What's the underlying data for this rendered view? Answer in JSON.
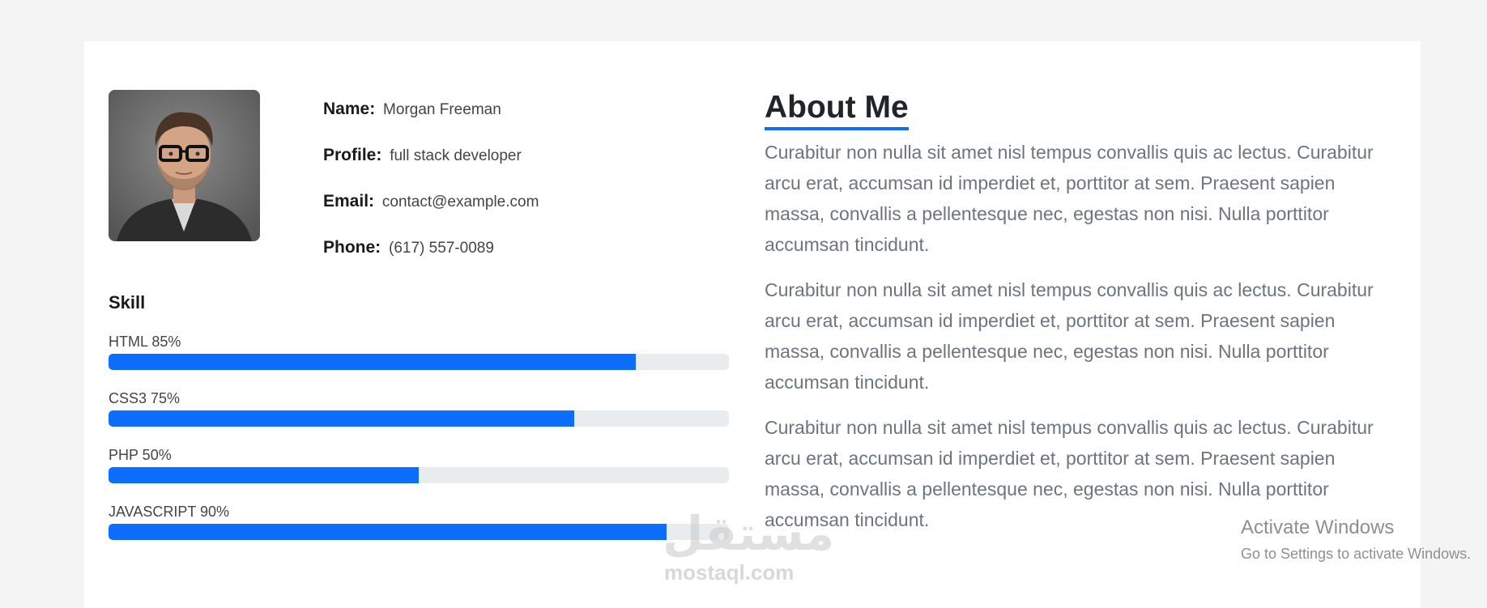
{
  "profile": {
    "photo_alt": "",
    "fields": [
      {
        "key": "Name:",
        "value": "Morgan Freeman"
      },
      {
        "key": "Profile:",
        "value": "full stack developer"
      },
      {
        "key": "Email:",
        "value": "contact@example.com"
      },
      {
        "key": "Phone:",
        "value": "(617) 557-0089"
      }
    ]
  },
  "skills": {
    "title": "Skill",
    "items": [
      {
        "label": "HTML 85%",
        "percent": 85
      },
      {
        "label": "CSS3 75%",
        "percent": 75
      },
      {
        "label": "PHP 50%",
        "percent": 50
      },
      {
        "label": "JAVASCRIPT 90%",
        "percent": 90
      }
    ]
  },
  "about": {
    "title": "About Me",
    "paragraphs": [
      "Curabitur non nulla sit amet nisl tempus convallis quis ac lectus. Curabitur arcu erat, accumsan id imperdiet et, porttitor at sem. Praesent sapien massa, convallis a pellentesque nec, egestas non nisi. Nulla porttitor accumsan tincidunt.",
      "Curabitur non nulla sit amet nisl tempus convallis quis ac lectus. Curabitur arcu erat, accumsan id imperdiet et, porttitor at sem. Praesent sapien massa, convallis a pellentesque nec, egestas non nisi. Nulla porttitor accumsan tincidunt.",
      "Curabitur non nulla sit amet nisl tempus convallis quis ac lectus. Curabitur arcu erat, accumsan id imperdiet et, porttitor at sem. Praesent sapien massa, convallis a pellentesque nec, egestas non nisi. Nulla porttitor accumsan tincidunt."
    ]
  },
  "overlay": {
    "watermark_logo": "مستقل",
    "watermark_site": "mostaql.com",
    "activate_title": "Activate Windows",
    "activate_sub": "Go to Settings to activate Windows."
  },
  "colors": {
    "accent": "#0d6efd",
    "track": "#e9ecef",
    "muted_text": "#6c757d",
    "page_bg": "#f4f4f4"
  }
}
